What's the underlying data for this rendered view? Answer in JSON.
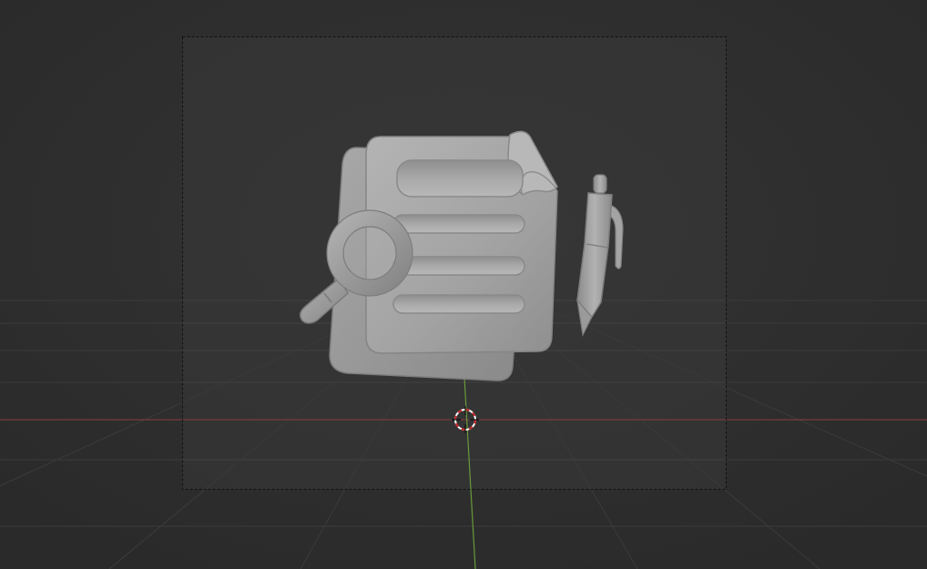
{
  "app": "Blender",
  "viewport": {
    "mode": "camera-view",
    "background_color": "#2b2b2b",
    "camera_frame_color": "#363636",
    "grid_color": "#3a3a3a",
    "x_axis_color": "#8a3d3d",
    "y_axis_color": "#6a9a3a",
    "model_color": "#9e9e9e"
  },
  "scene": {
    "objects": [
      {
        "name": "document-stack",
        "icon": "document-icon"
      },
      {
        "name": "magnifying-glass",
        "icon": "magnifier-icon"
      },
      {
        "name": "pen",
        "icon": "pen-icon"
      }
    ],
    "cursor": "3d-cursor-icon"
  }
}
